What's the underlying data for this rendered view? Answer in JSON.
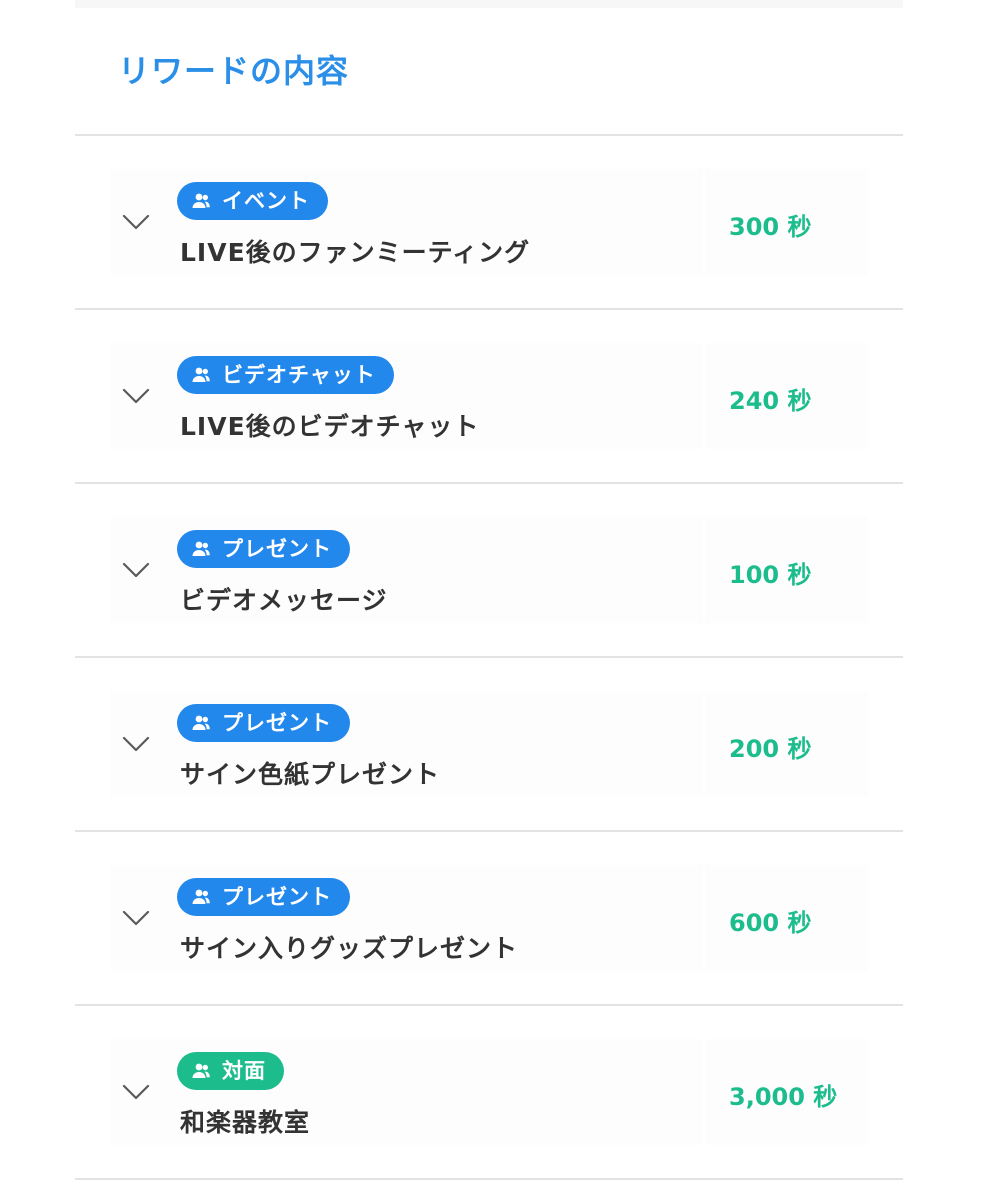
{
  "section_title": "リワードの内容",
  "colors": {
    "title": "#2b8fe8",
    "badge_blue": "#2388ec",
    "badge_green": "#1cbc8c",
    "seconds": "#1cbc8c",
    "name": "#333333",
    "divider": "#e3e3e3"
  },
  "rewards": [
    {
      "category": "イベント",
      "category_color": "blue",
      "category_icon": "users-icon",
      "name": "LIVE後のファンミーティング",
      "seconds": "300 秒",
      "toggle_icon": "chevron-down-icon"
    },
    {
      "category": "ビデオチャット",
      "category_color": "blue",
      "category_icon": "users-icon",
      "name": "LIVE後のビデオチャット",
      "seconds": "240 秒",
      "toggle_icon": "chevron-down-icon"
    },
    {
      "category": "プレゼント",
      "category_color": "blue",
      "category_icon": "users-icon",
      "name": "ビデオメッセージ",
      "seconds": "100 秒",
      "toggle_icon": "chevron-down-icon"
    },
    {
      "category": "プレゼント",
      "category_color": "blue",
      "category_icon": "users-icon",
      "name": "サイン色紙プレゼント",
      "seconds": "200 秒",
      "toggle_icon": "chevron-down-icon"
    },
    {
      "category": "プレゼント",
      "category_color": "blue",
      "category_icon": "users-icon",
      "name": "サイン入りグッズプレゼント",
      "seconds": "600 秒",
      "toggle_icon": "chevron-down-icon"
    },
    {
      "category": "対面",
      "category_color": "green",
      "category_icon": "users-icon",
      "name": "和楽器教室",
      "seconds": "3,000 秒",
      "toggle_icon": "chevron-down-icon"
    }
  ]
}
